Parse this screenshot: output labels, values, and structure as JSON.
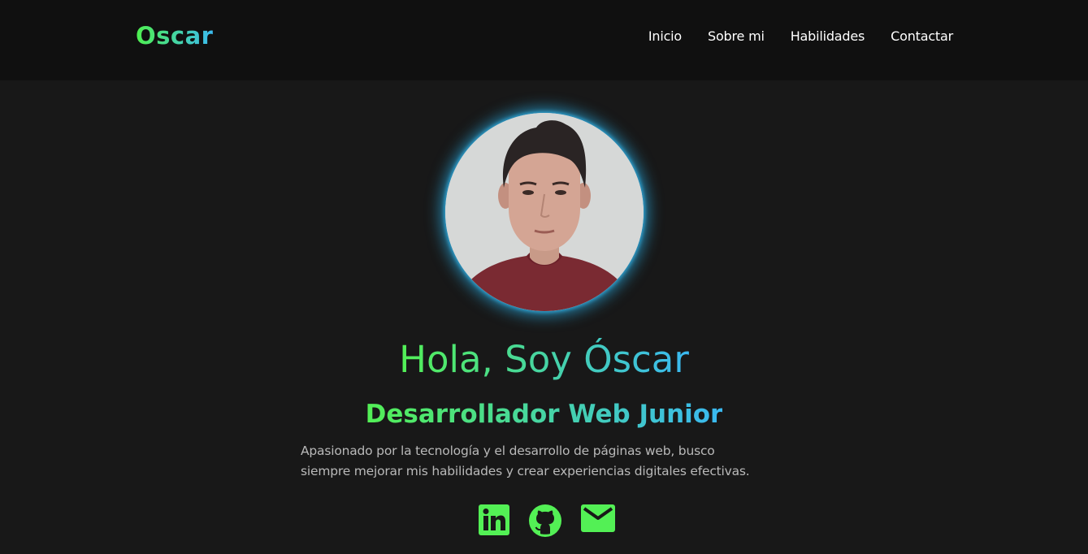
{
  "header": {
    "logo": "Oscar",
    "nav": [
      "Inicio",
      "Sobre mi",
      "Habilidades",
      "Contactar"
    ]
  },
  "hero": {
    "title": "Hola, Soy Óscar",
    "subtitle": "Desarrollador Web Junior",
    "description_line1": "Apasionado por la tecnología y el desarrollo de páginas web, busco",
    "description_line2": "siempre mejorar mis habilidades y crear experiencias digitales efectivas."
  },
  "socials": [
    {
      "icon": "linkedin-icon"
    },
    {
      "icon": "github-icon"
    },
    {
      "icon": "mail-icon"
    }
  ],
  "colors": {
    "accent_green": "#53f055",
    "accent_blue": "#3ab9f2",
    "background": "#181818",
    "header_background": "#101010"
  }
}
